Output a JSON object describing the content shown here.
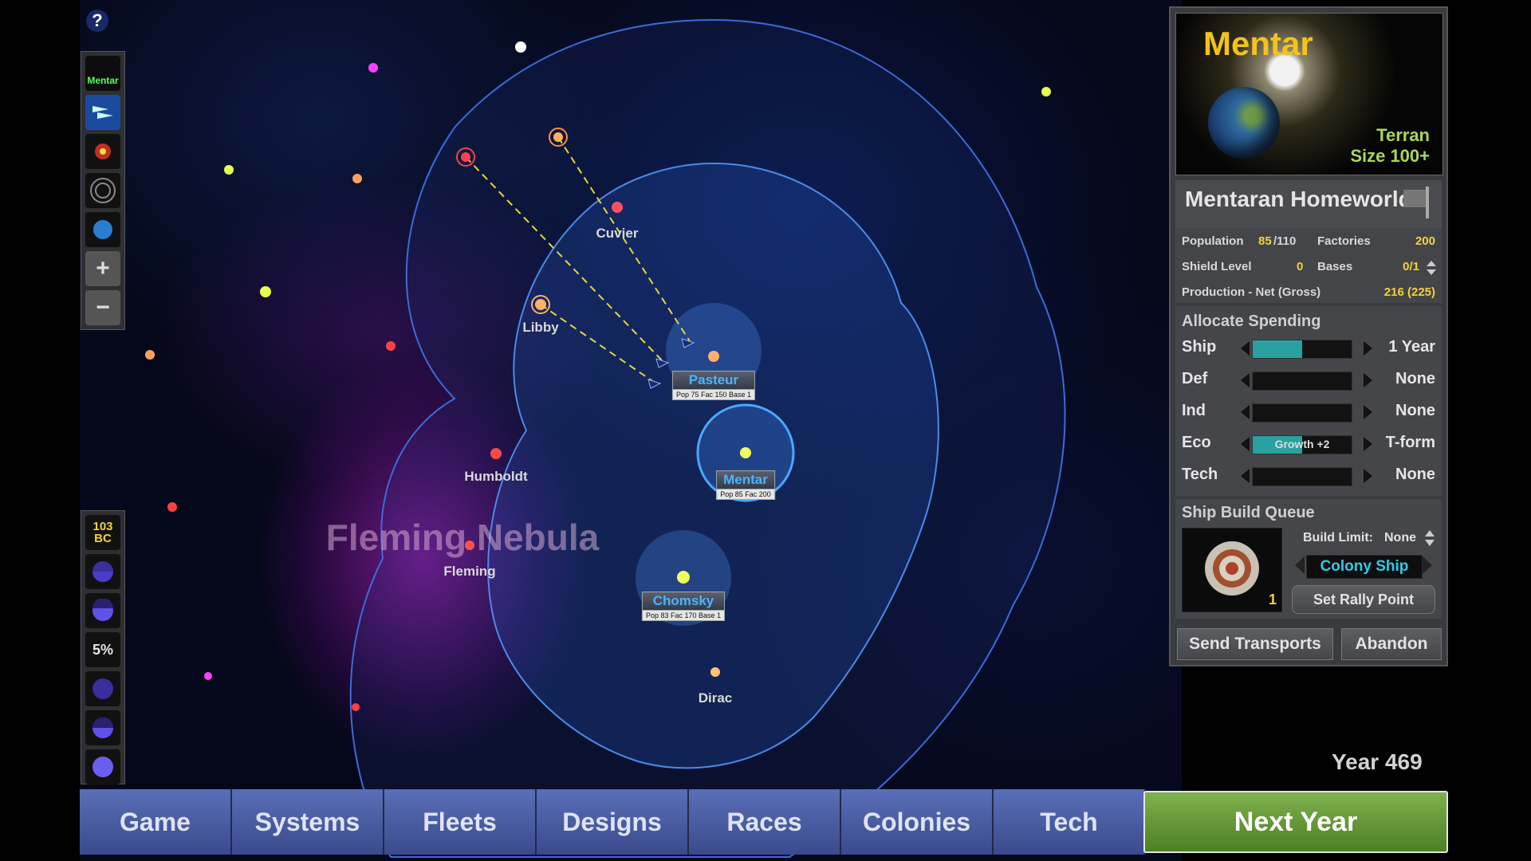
{
  "map": {
    "nebula_label": "Fleming Nebula",
    "stars": [
      {
        "name": "Cuvier",
        "color": "#ff5060"
      },
      {
        "name": "Libby",
        "color": "#ffb060"
      },
      {
        "name": "Humboldt",
        "color": "#ff4a4a"
      },
      {
        "name": "Fleming",
        "color": "#ff5050"
      },
      {
        "name": "Dirac",
        "color": "#ffc070"
      },
      {
        "name": "Pasteur",
        "color": "#ffb070"
      },
      {
        "name": "Mentar",
        "color": "#f0ff60"
      },
      {
        "name": "Chomsky",
        "color": "#f0ff60"
      }
    ],
    "colonies": [
      {
        "name": "Pasteur",
        "stats": "Pop 75 Fac 150 Base 1"
      },
      {
        "name": "Mentar",
        "stats": "Pop 85 Fac 200"
      },
      {
        "name": "Chomsky",
        "stats": "Pop 83 Fac 170 Base 1"
      }
    ]
  },
  "left_toolbar": {
    "help_label": "?",
    "top_buttons": [
      {
        "label": "Mentar",
        "icon": "mentar-planet-icon"
      },
      {
        "label": "",
        "icon": "fleet-icon"
      },
      {
        "label": "",
        "icon": "star-icon"
      },
      {
        "label": "",
        "icon": "range-rings-icon"
      },
      {
        "label": "",
        "icon": "blue-planet-icon"
      },
      {
        "label": "+",
        "icon": "zoom-in-icon"
      },
      {
        "label": "−",
        "icon": "zoom-out-icon"
      }
    ],
    "bottom_buttons": [
      {
        "label": "103\nBC",
        "icon": "treasury-icon"
      },
      {
        "label": "",
        "icon": "moon-phase-icon"
      },
      {
        "label": "",
        "icon": "moon-phase-icon"
      },
      {
        "label": "5%",
        "icon": "tax-icon"
      },
      {
        "label": "",
        "icon": "moon-phase-icon"
      },
      {
        "label": "",
        "icon": "moon-phase-icon"
      },
      {
        "label": "",
        "icon": "moon-phase-icon"
      }
    ]
  },
  "panel": {
    "planet_name": "Mentar",
    "planet_type": "Terran",
    "planet_size": "Size 100+",
    "colony_title": "Mentaran Homeworld",
    "stats": {
      "population_label": "Population",
      "population_value": "85",
      "population_max": "/110",
      "factories_label": "Factories",
      "factories_value": "200",
      "shield_label": "Shield Level",
      "shield_value": "0",
      "bases_label": "Bases",
      "bases_value": "0/1",
      "production_label": "Production - Net (Gross)",
      "production_value": "216  (225)"
    },
    "allocate_title": "Allocate Spending",
    "allocations": [
      {
        "name": "Ship",
        "fill": 0.5,
        "bar_text": "",
        "value": "1 Year"
      },
      {
        "name": "Def",
        "fill": 0.0,
        "bar_text": "",
        "value": "None"
      },
      {
        "name": "Ind",
        "fill": 0.0,
        "bar_text": "",
        "value": "None"
      },
      {
        "name": "Eco",
        "fill": 0.5,
        "bar_text": "Growth +2",
        "value": "T-form"
      },
      {
        "name": "Tech",
        "fill": 0.0,
        "bar_text": "",
        "value": "None"
      }
    ],
    "build_queue_title": "Ship Build Queue",
    "build_limit_label": "Build Limit:",
    "build_limit_value": "None",
    "ship_name": "Colony Ship",
    "ship_count": "1",
    "rally_button": "Set Rally Point",
    "send_transports_button": "Send Transports",
    "abandon_button": "Abandon"
  },
  "bottom_bar": {
    "tabs": [
      "Game",
      "Systems",
      "Fleets",
      "Designs",
      "Races",
      "Colonies",
      "Tech"
    ],
    "next_year": "Next Year",
    "year": "Year 469"
  },
  "colors": {
    "accent_gold": "#f2d23a",
    "teal_bar": "#2aa0a0",
    "tab_blue": "#4a5ea4",
    "next_year_green": "#6a9f3c",
    "colony_blue": "#49b4ff"
  }
}
